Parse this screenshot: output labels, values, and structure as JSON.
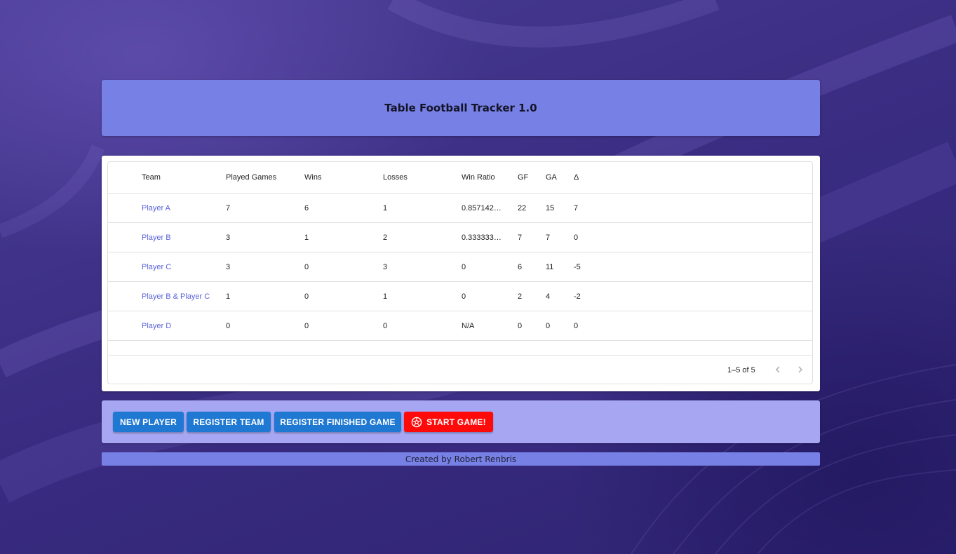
{
  "app": {
    "title": "Table Football Tracker 1.0",
    "credits": "Created by Robert Renbris"
  },
  "table": {
    "columns": {
      "team": "Team",
      "played": "Played Games",
      "wins": "Wins",
      "losses": "Losses",
      "ratio": "Win Ratio",
      "gf": "GF",
      "ga": "GA",
      "delta": "Δ"
    },
    "rows": [
      {
        "team": "Player A",
        "played": "7",
        "wins": "6",
        "losses": "1",
        "ratio": "0.857142857142857",
        "gf": "22",
        "ga": "15",
        "delta": "7"
      },
      {
        "team": "Player B",
        "played": "3",
        "wins": "1",
        "losses": "2",
        "ratio": "0.333333333333333",
        "gf": "7",
        "ga": "7",
        "delta": "0"
      },
      {
        "team": "Player C",
        "played": "3",
        "wins": "0",
        "losses": "3",
        "ratio": "0",
        "gf": "6",
        "ga": "11",
        "delta": "-5"
      },
      {
        "team": "Player B & Player C",
        "played": "1",
        "wins": "0",
        "losses": "1",
        "ratio": "0",
        "gf": "2",
        "ga": "4",
        "delta": "-2"
      },
      {
        "team": "Player D",
        "played": "0",
        "wins": "0",
        "losses": "0",
        "ratio": "N/A",
        "gf": "0",
        "ga": "0",
        "delta": "0"
      }
    ],
    "pagination": {
      "range_text": "1–5 of 5",
      "prev_icon": "chevron-left-icon",
      "next_icon": "chevron-right-icon"
    }
  },
  "actions": {
    "new_player": "NEW PLAYER",
    "register_team": "REGISTER TEAM",
    "register_finished_game": "REGISTER FINISHED GAME",
    "start_game": "START GAME!",
    "start_game_icon": "soccer-ball-icon"
  },
  "colors": {
    "header_bg": "#7780e4",
    "actions_bg": "#a6a6f2",
    "button_blue": "#1f78d1",
    "button_red": "#ff0a0a",
    "link": "#5a63d6"
  }
}
